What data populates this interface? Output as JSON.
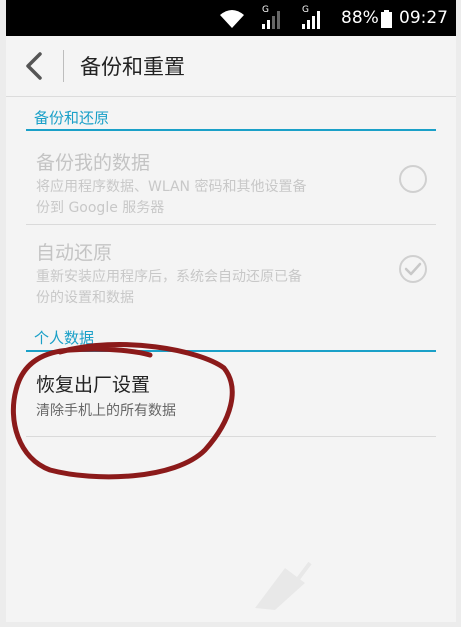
{
  "status_bar": {
    "network_label": "G",
    "battery": "88%",
    "time": "09:27"
  },
  "header": {
    "title": "备份和重置"
  },
  "sections": [
    {
      "header": "备份和还原",
      "items": [
        {
          "title": "备份我的数据",
          "subtitle_line1": "将应用程序数据、WLAN 密码和其他设置备",
          "subtitle_line2": "份到 Google 服务器",
          "checked": false,
          "enabled": false
        },
        {
          "title": "自动还原",
          "subtitle_line1": "重新安装应用程序后，系统会自动还原已备",
          "subtitle_line2": "份的设置和数据",
          "checked": true,
          "enabled": false
        }
      ]
    },
    {
      "header": "个人数据",
      "items": [
        {
          "title": "恢复出厂设置",
          "subtitle_line1": "清除手机上的所有数据",
          "enabled": true
        }
      ]
    }
  ],
  "colors": {
    "accent": "#1aa0c8",
    "annotation": "#8b1a1a"
  }
}
